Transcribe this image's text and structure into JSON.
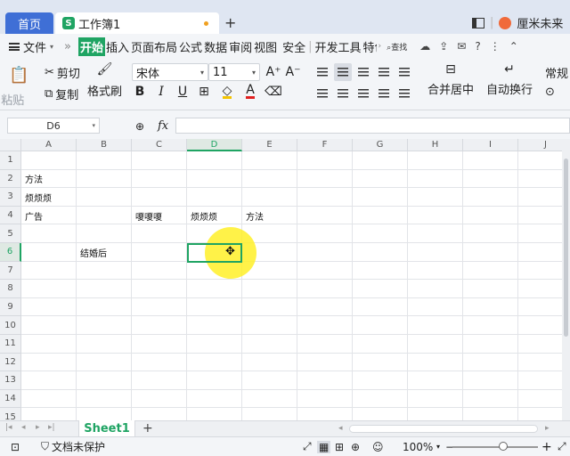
{
  "tabs": {
    "home": "首页",
    "doc_title": "工作簿1",
    "doc_badge": "S",
    "new_tab": "+"
  },
  "account": {
    "name": "厘米未来"
  },
  "menu": {
    "file": "文件",
    "more": "»",
    "items": [
      "开始",
      "插入",
      "页面布局",
      "公式",
      "数据",
      "审阅",
      "视图",
      "安全",
      "开发工具",
      "特色"
    ],
    "active_index": 0,
    "search": "查找"
  },
  "ribbon": {
    "paste": "粘贴",
    "cut": "剪切",
    "copy": "复制",
    "format_painter": "格式刷",
    "font_name": "宋体",
    "font_size": "11",
    "increase_font": "A⁺",
    "decrease_font": "A⁻",
    "bold": "B",
    "italic": "I",
    "underline": "U",
    "font_color_letter": "A",
    "merge_center": "合并居中",
    "wrap_text": "自动换行",
    "common": "常规",
    "font_color": "#e02020",
    "fill_color": "#f3c300"
  },
  "formula_bar": {
    "name_box": "D6",
    "fx": "fx",
    "formula": ""
  },
  "grid": {
    "columns": [
      "A",
      "B",
      "C",
      "D",
      "E",
      "F",
      "G",
      "H",
      "I",
      "J"
    ],
    "rows": [
      "1",
      "2",
      "3",
      "4",
      "5",
      "6",
      "7",
      "8",
      "9",
      "10",
      "11",
      "12",
      "13",
      "14",
      "15"
    ],
    "selected_cell": "D6",
    "cells": {
      "A2": "方法",
      "A3": "烦烦烦",
      "A4": "广告",
      "C4": "嗄嗄嗄",
      "D4": "烦烦烦",
      "E4": "方法",
      "B6": "结婚后"
    }
  },
  "sheets": {
    "active": "Sheet1",
    "add": "+"
  },
  "status": {
    "doc_protect": "文档未保护",
    "zoom": "100%",
    "zoom_level": 1.0,
    "minus": "−",
    "plus": "+"
  },
  "colors": {
    "accent": "#1fa463",
    "home_tab": "#3f6fd6",
    "highlight": "#fff028"
  }
}
